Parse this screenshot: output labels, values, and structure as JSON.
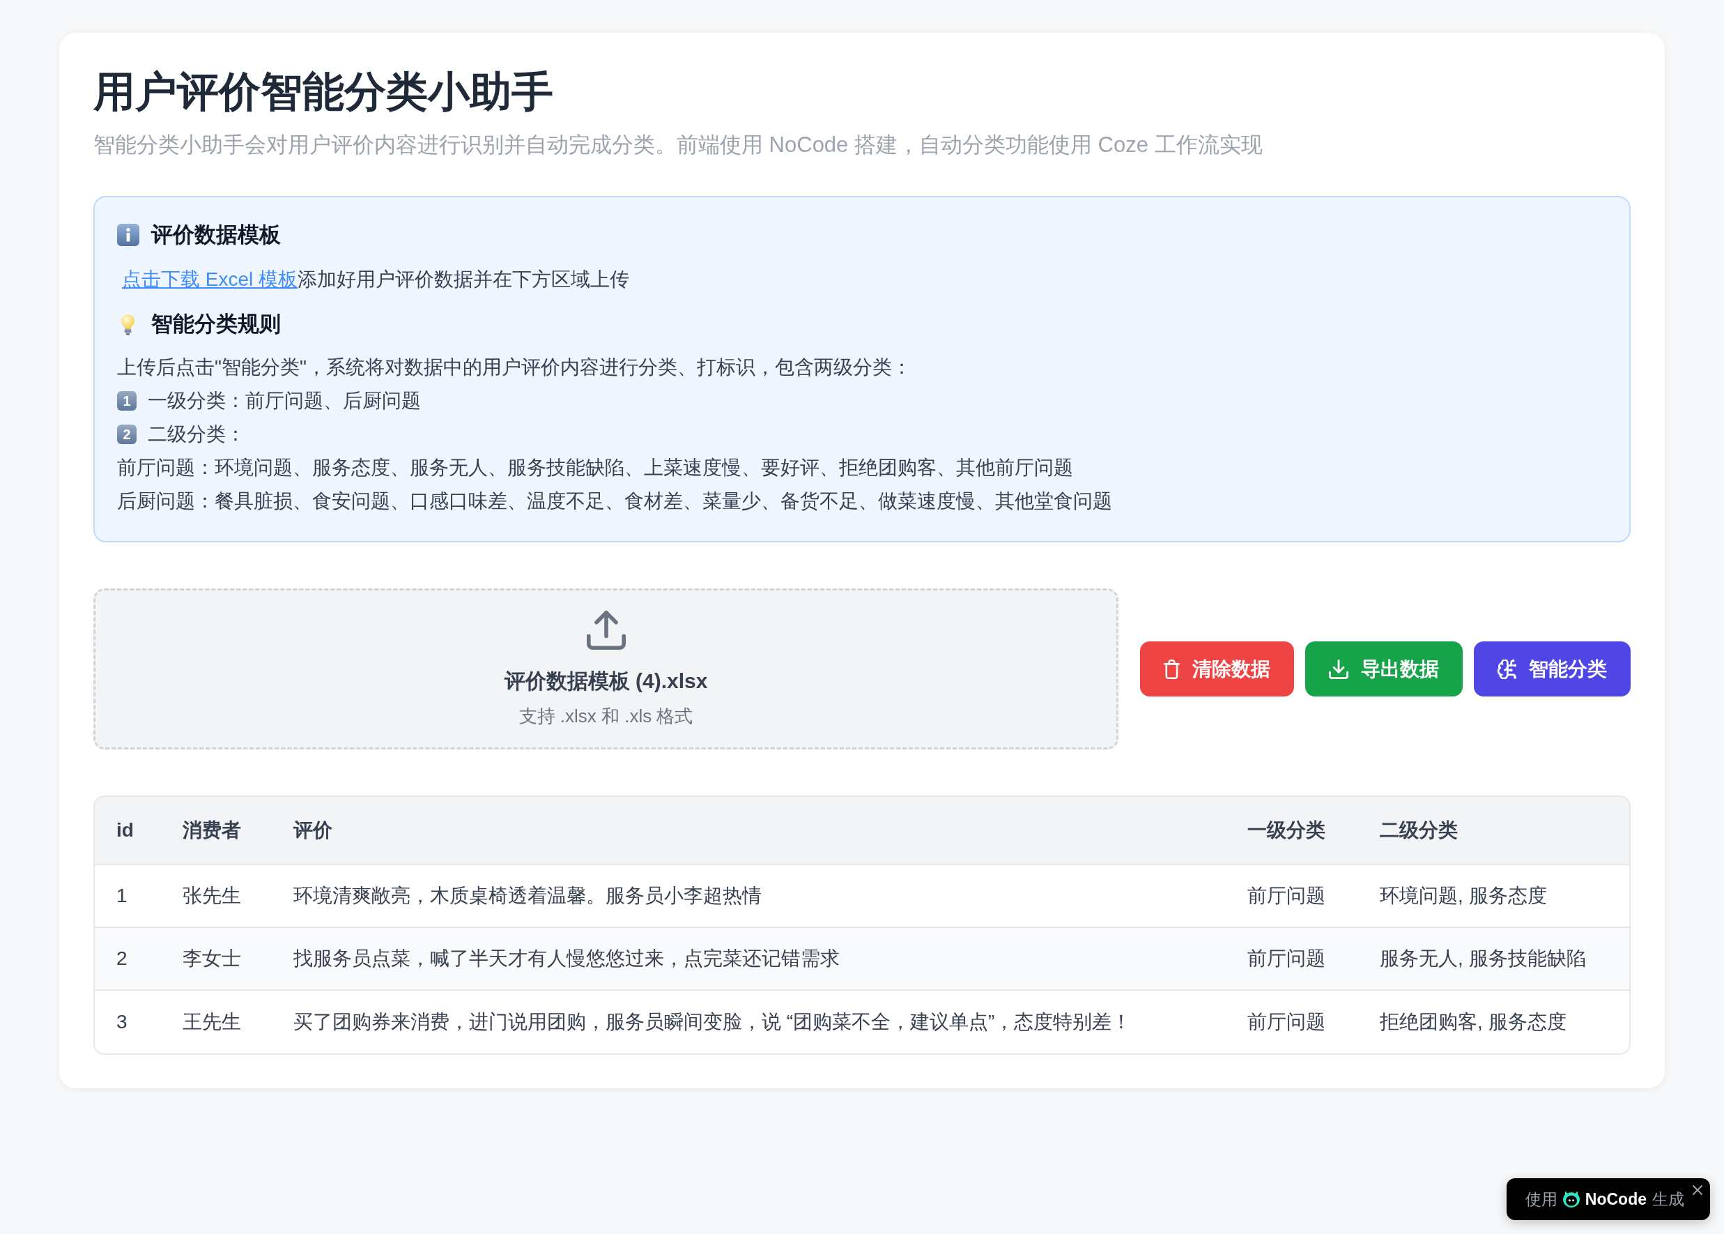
{
  "header": {
    "title": "用户评价智能分类小助手",
    "subtitle": "智能分类小助手会对用户评价内容进行识别并自动完成分类。前端使用 NoCode 搭建，自动分类功能使用 Coze 工作流实现"
  },
  "info_panel": {
    "template": {
      "heading": "评价数据模板",
      "link": "点击下载 Excel 模板",
      "text": "添加好用户评价数据并在下方区域上传"
    },
    "rules": {
      "heading": "智能分类规则",
      "intro": "上传后点击\"智能分类\"，系统将对数据中的用户评价内容进行分类、打标识，包含两级分类：",
      "levels": [
        {
          "number": "1",
          "text": "一级分类：前厅问题、后厨问题"
        },
        {
          "number": "2",
          "text": "二级分类："
        }
      ],
      "details": [
        "前厅问题：环境问题、服务态度、服务无人、服务技能缺陷、上菜速度慢、要好评、拒绝团购客、其他前厅问题",
        "后厨问题：餐具脏损、食安问题、口感口味差、温度不足、食材差、菜量少、备货不足、做菜速度慢、其他堂食问题"
      ]
    }
  },
  "upload": {
    "file_name": "评价数据模板 (4).xlsx",
    "hint": "支持 .xlsx 和 .xls 格式"
  },
  "actions": [
    {
      "kind": "clear",
      "label": "清除数据"
    },
    {
      "kind": "export",
      "label": "导出数据"
    },
    {
      "kind": "classify",
      "label": "智能分类"
    }
  ],
  "table": {
    "columns": [
      "id",
      "消费者",
      "评价",
      "一级分类",
      "二级分类"
    ],
    "rows": [
      [
        "1",
        "张先生",
        "环境清爽敞亮，木质桌椅透着温馨。服务员小李超热情",
        "前厅问题",
        "环境问题, 服务态度"
      ],
      [
        "2",
        "李女士",
        "找服务员点菜，喊了半天才有人慢悠悠过来，点完菜还记错需求",
        "前厅问题",
        "服务无人, 服务技能缺陷"
      ],
      [
        "3",
        "王先生",
        "买了团购券来消费，进门说用团购，服务员瞬间变脸，说 “团购菜不全，建议单点”，态度特别差！",
        "前厅问题",
        "拒绝团购客, 服务态度"
      ]
    ]
  },
  "badge": {
    "prefix": "使用",
    "brand": "NoCode",
    "suffix": "生成"
  }
}
